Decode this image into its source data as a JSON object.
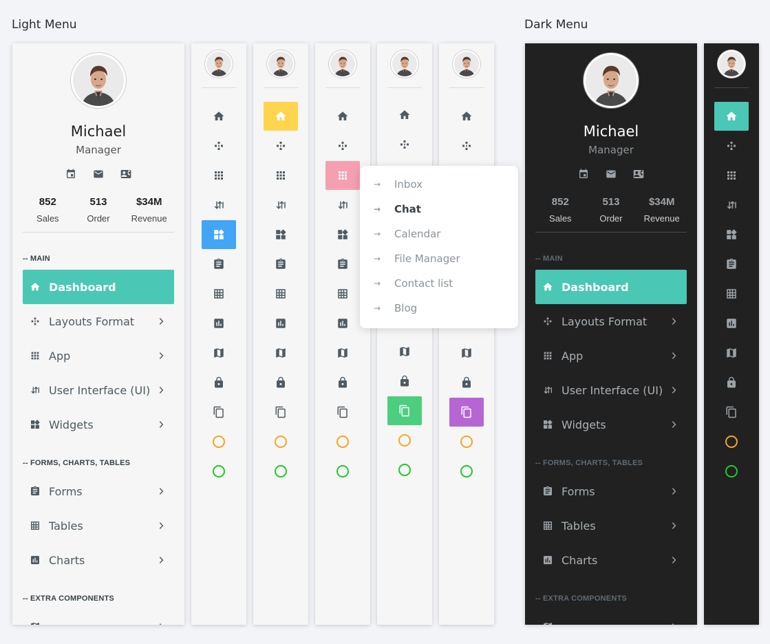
{
  "sections": {
    "light_title": "Light Menu",
    "dark_title": "Dark Menu"
  },
  "profile": {
    "name": "Michael",
    "role": "Manager",
    "icons": [
      "calendar-icon",
      "mail-icon",
      "contact-card-icon"
    ],
    "stats": [
      {
        "value": "852",
        "label": "Sales"
      },
      {
        "value": "513",
        "label": "Order"
      },
      {
        "value": "$34M",
        "label": "Revenue"
      }
    ]
  },
  "menu": {
    "heading_main": "-- MAIN",
    "heading_forms": "-- FORMS, CHARTS, TABLES",
    "heading_extra": "-- EXTRA COMPONENTS",
    "items": [
      {
        "label": "Dashboard",
        "icon": "home-icon",
        "active": true
      },
      {
        "label": "Layouts Format",
        "icon": "layouts-icon"
      },
      {
        "label": "App",
        "icon": "apps-grid-icon"
      },
      {
        "label": "User Interface (UI)",
        "icon": "ui-icon"
      },
      {
        "label": "Widgets",
        "icon": "widgets-icon"
      },
      {
        "label": "Forms",
        "icon": "clipboard-icon"
      },
      {
        "label": "Tables",
        "icon": "table-icon"
      },
      {
        "label": "Charts",
        "icon": "chart-icon"
      }
    ]
  },
  "compact_highlights": {
    "yellow": "#ffd54f",
    "blue": "#42a5f5",
    "pink": "#f5a0b0",
    "green": "#4cce7e",
    "purple": "#b566d3",
    "teal": "#4ac7b5"
  },
  "status_colors": {
    "ring_orange": "#f5a623",
    "ring_green": "#23c82b",
    "accent": "#4ac7b5"
  },
  "popover": {
    "items": [
      {
        "label": "Inbox"
      },
      {
        "label": "Chat",
        "active": true
      },
      {
        "label": "Calendar"
      },
      {
        "label": "File Manager"
      },
      {
        "label": "Contact list"
      },
      {
        "label": "Blog"
      }
    ],
    "arrow": "→"
  }
}
